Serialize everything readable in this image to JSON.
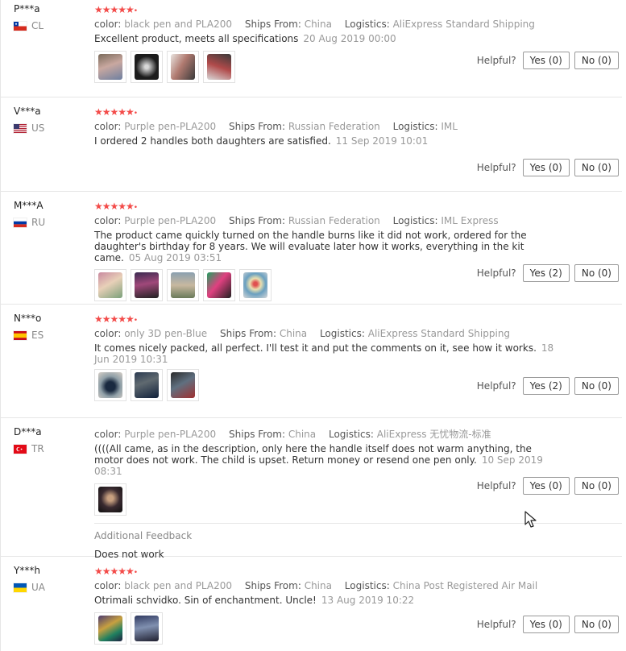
{
  "helpful_label": "Helpful?",
  "rating_stars": "★★★★★",
  "reviews": [
    {
      "user": "P***a",
      "country": "CL",
      "flag": "cl",
      "stars": true,
      "attr_color_key": "color:",
      "color": "black pen and PLA200",
      "attr_ships_key": "Ships From:",
      "ships_from": "China",
      "attr_logistics_key": "Logistics:",
      "logistics": "AliExpress Standard Shipping",
      "text": "Excellent product, meets all specifications",
      "date": "20 Aug 2019 00:00",
      "photos": 4,
      "yes": "Yes (0)",
      "no": "No (0)"
    },
    {
      "user": "V***a",
      "country": "US",
      "flag": "us",
      "stars": true,
      "attr_color_key": "color:",
      "color": "Purple pen-PLA200",
      "attr_ships_key": "Ships From:",
      "ships_from": "Russian Federation",
      "attr_logistics_key": "Logistics:",
      "logistics": "IML",
      "text": "I ordered 2 handles both daughters are satisfied.",
      "date": "11 Sep 2019 10:01",
      "photos": 0,
      "yes": "Yes (0)",
      "no": "No (0)"
    },
    {
      "user": "M***A",
      "country": "RU",
      "flag": "ru",
      "stars": true,
      "attr_color_key": "color:",
      "color": "Purple pen-PLA200",
      "attr_ships_key": "Ships From:",
      "ships_from": "Russian Federation",
      "attr_logistics_key": "Logistics:",
      "logistics": "IML Express",
      "text": "The product came quickly turned on the handle burns like it did not work, ordered for the daughter's birthday for 8 years. We will evaluate later how it works, everything in the kit came.",
      "date": "05 Aug 2019 03:51",
      "photos": 5,
      "yes": "Yes (2)",
      "no": "No (0)"
    },
    {
      "user": "N***o",
      "country": "ES",
      "flag": "es",
      "stars": true,
      "attr_color_key": "color:",
      "color": "only 3D pen-Blue",
      "attr_ships_key": "Ships From:",
      "ships_from": "China",
      "attr_logistics_key": "Logistics:",
      "logistics": "AliExpress Standard Shipping",
      "text": "It comes nicely packed, all perfect. I'll test it and put the comments on it, see how it works.",
      "date": "18 Jun 2019 10:31",
      "photos": 3,
      "yes": "Yes (2)",
      "no": "No (0)"
    },
    {
      "user": "D***a",
      "country": "TR",
      "flag": "tr",
      "stars": false,
      "attr_color_key": "color:",
      "color": "Purple pen-PLA200",
      "attr_ships_key": "Ships From:",
      "ships_from": "China",
      "attr_logistics_key": "Logistics:",
      "logistics": "AliExpress 无忧物流-标准",
      "text": "((((All came, as in the description, only here the handle itself does not warm anything, the motor does not work. The child is upset. Return money or resend one pen only.",
      "date": "10 Sep 2019 08:31",
      "photos": 1,
      "yes": "Yes (0)",
      "no": "No (0)",
      "additional_title": "Additional Feedback",
      "additional_text": "Does not work"
    },
    {
      "user": "Y***h",
      "country": "UA",
      "flag": "ua",
      "stars": true,
      "attr_color_key": "color:",
      "color": "black pen and PLA200",
      "attr_ships_key": "Ships From:",
      "ships_from": "China",
      "attr_logistics_key": "Logistics:",
      "logistics": "China Post Registered Air Mail",
      "text": "Otrimali schvidko. Sin of enchantment. Uncle!",
      "date": "13 Aug 2019 10:22",
      "photos": 2,
      "yes": "Yes (0)",
      "no": "No (0)"
    }
  ],
  "colors": {
    "star": "#f34b49",
    "divider": "#e6e6e6",
    "muted": "#999999"
  },
  "icons": {
    "cursor": "mouse-pointer-icon"
  }
}
